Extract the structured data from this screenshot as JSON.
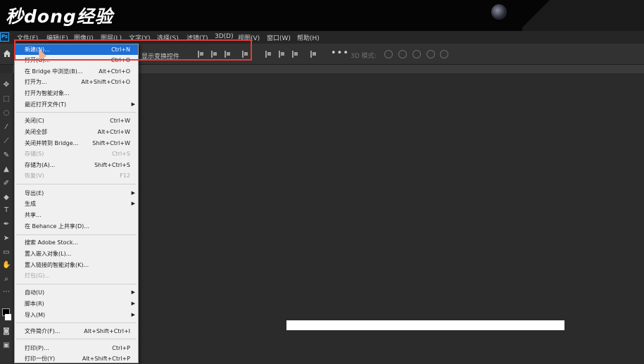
{
  "watermark": {
    "text": "秒dong经验"
  },
  "app": {
    "logo": "Ps"
  },
  "menubar": {
    "items": [
      {
        "label": "文件(F)"
      },
      {
        "label": "编辑(E)"
      },
      {
        "label": "图像(I)"
      },
      {
        "label": "图层(L)"
      },
      {
        "label": "文字(Y)"
      },
      {
        "label": "选择(S)"
      },
      {
        "label": "滤镜(T)"
      },
      {
        "label": "3D(D)"
      },
      {
        "label": "视图(V)"
      },
      {
        "label": "窗口(W)"
      },
      {
        "label": "帮助(H)"
      }
    ]
  },
  "options_bar": {
    "transform_controls_label": "显示变换控件",
    "mode_label": "3D 模式:",
    "more_icon": "more-horizontal-icon"
  },
  "file_menu": {
    "items": [
      {
        "label": "新建(N)...",
        "shortcut": "Ctrl+N",
        "state": "highlight"
      },
      {
        "label": "打开(O)...",
        "shortcut": "Ctrl+O",
        "state": "normal"
      },
      {
        "label": "在 Bridge 中浏览(B)...",
        "shortcut": "Alt+Ctrl+O",
        "state": "normal"
      },
      {
        "label": "打开为...",
        "shortcut": "Alt+Shift+Ctrl+O",
        "state": "normal"
      },
      {
        "label": "打开为智能对象...",
        "shortcut": "",
        "state": "normal"
      },
      {
        "label": "最近打开文件(T)",
        "shortcut": "",
        "state": "submenu"
      },
      {
        "label": "关闭(C)",
        "shortcut": "Ctrl+W",
        "state": "normal"
      },
      {
        "label": "关闭全部",
        "shortcut": "Alt+Ctrl+W",
        "state": "normal"
      },
      {
        "label": "关闭并转到 Bridge...",
        "shortcut": "Shift+Ctrl+W",
        "state": "normal"
      },
      {
        "label": "存储(S)",
        "shortcut": "Ctrl+S",
        "state": "disabled"
      },
      {
        "label": "存储为(A)...",
        "shortcut": "Shift+Ctrl+S",
        "state": "normal"
      },
      {
        "label": "恢复(V)",
        "shortcut": "F12",
        "state": "disabled"
      },
      {
        "label": "导出(E)",
        "shortcut": "",
        "state": "submenu"
      },
      {
        "label": "生成",
        "shortcut": "",
        "state": "submenu"
      },
      {
        "label": "共享...",
        "shortcut": "",
        "state": "normal"
      },
      {
        "label": "在 Behance 上共享(D)...",
        "shortcut": "",
        "state": "normal"
      },
      {
        "label": "搜索 Adobe Stock...",
        "shortcut": "",
        "state": "normal"
      },
      {
        "label": "置入嵌入对象(L)...",
        "shortcut": "",
        "state": "normal"
      },
      {
        "label": "置入链接的智能对象(K)...",
        "shortcut": "",
        "state": "normal"
      },
      {
        "label": "打包(G)...",
        "shortcut": "",
        "state": "disabled"
      },
      {
        "label": "自动(U)",
        "shortcut": "",
        "state": "submenu"
      },
      {
        "label": "脚本(R)",
        "shortcut": "",
        "state": "submenu"
      },
      {
        "label": "导入(M)",
        "shortcut": "",
        "state": "submenu"
      },
      {
        "label": "文件简介(F)...",
        "shortcut": "Alt+Shift+Ctrl+I",
        "state": "normal"
      },
      {
        "label": "打印(P)...",
        "shortcut": "Ctrl+P",
        "state": "normal"
      },
      {
        "label": "打印一份(Y)",
        "shortcut": "Alt+Shift+Ctrl+P",
        "state": "normal"
      }
    ]
  },
  "colors": {
    "highlight": "#1f6fd4",
    "annotation_box": "#e23b3b",
    "workspace": "#2b2b2b"
  }
}
